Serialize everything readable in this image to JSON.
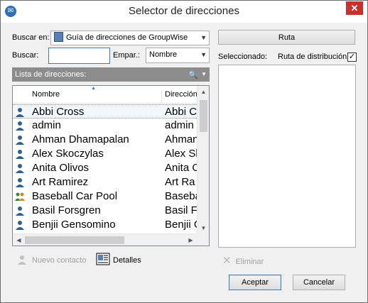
{
  "window": {
    "title": "Selector de direcciones",
    "close_glyph": "✕"
  },
  "search_in": {
    "label": "Buscar en:",
    "value": "Guía de direcciones de GroupWise"
  },
  "route_button": {
    "label": "Ruta"
  },
  "search": {
    "label": "Buscar:",
    "value": "",
    "match_label": "Empar.:",
    "match_value": "Nombre"
  },
  "selected": {
    "label": "Seleccionado:",
    "distribution_label": "Ruta de distribución",
    "distribution_checked": true
  },
  "list": {
    "header": "Lista de direcciones:",
    "columns": {
      "name": "Nombre",
      "address": "Dirección"
    },
    "rows": [
      {
        "name": "Abbi Cross",
        "address": "Abbi C",
        "icon": "person-icon",
        "selected": true
      },
      {
        "name": "admin",
        "address": "admin",
        "icon": "person-icon",
        "selected": false
      },
      {
        "name": "Ahman Dhamapalan",
        "address": "Ahman",
        "icon": "person-icon",
        "selected": false
      },
      {
        "name": "Alex Skoczylas",
        "address": "Alex Sk",
        "icon": "person-icon",
        "selected": false
      },
      {
        "name": "Anita Olivos",
        "address": "Anita O",
        "icon": "person-icon",
        "selected": false
      },
      {
        "name": "Art Ramirez",
        "address": "Art Ra",
        "icon": "person-icon",
        "selected": false
      },
      {
        "name": "Baseball Car Pool",
        "address": "Baseba",
        "icon": "group-icon",
        "selected": false
      },
      {
        "name": "Basil Forsgren",
        "address": "Basil F",
        "icon": "person-icon",
        "selected": false
      },
      {
        "name": "Benjii Gensomino",
        "address": "Benjii G",
        "icon": "person-icon",
        "selected": false
      }
    ]
  },
  "actions": {
    "new_contact": "Nuevo contacto",
    "details": "Detalles",
    "remove": "Eliminar"
  },
  "buttons": {
    "accept": "Aceptar",
    "cancel": "Cancelar"
  },
  "colors": {
    "list_header_bg": "#8c8c8c",
    "person_icon": "#2f5e94",
    "close_bg": "#c7302b"
  }
}
